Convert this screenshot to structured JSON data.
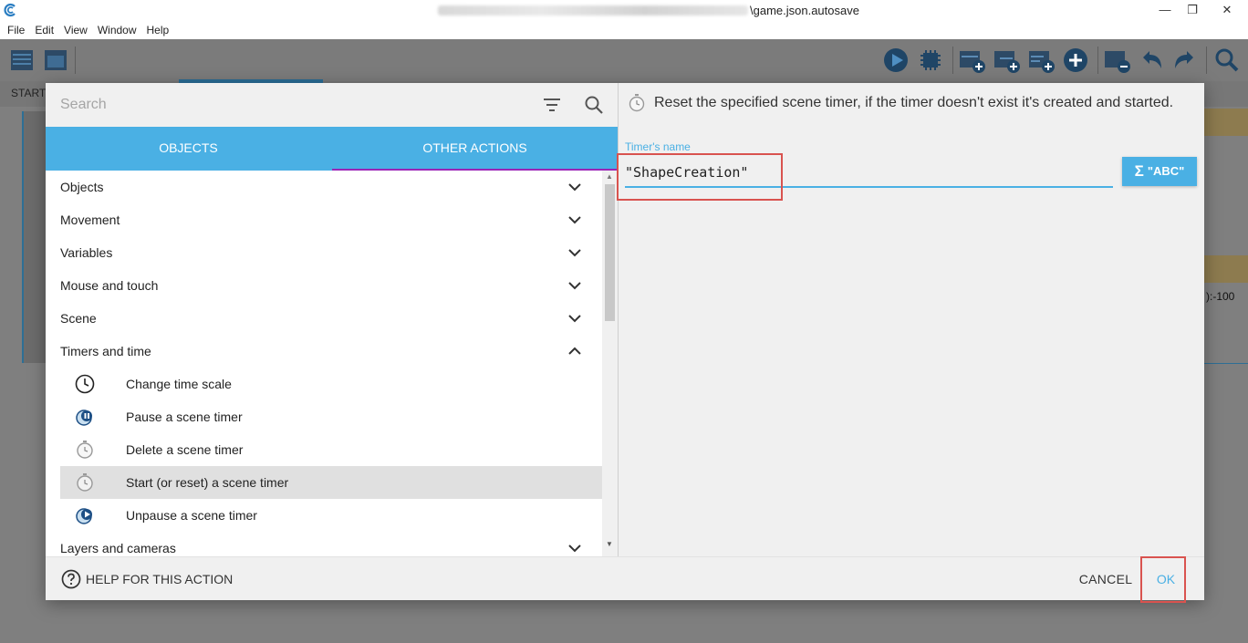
{
  "window": {
    "title_suffix": "\\game.json.autosave",
    "min_glyph": "—",
    "max_glyph": "❐",
    "close_glyph": "✕"
  },
  "menu": [
    "File",
    "Edit",
    "View",
    "Window",
    "Help"
  ],
  "background": {
    "tab_label": "START",
    "right_value": "):-100"
  },
  "search": {
    "placeholder": "Search"
  },
  "tabs": {
    "objects": "OBJECTS",
    "other_actions": "OTHER ACTIONS"
  },
  "categories": {
    "objects": "Objects",
    "movement": "Movement",
    "variables": "Variables",
    "mouse_touch": "Mouse and touch",
    "scene": "Scene",
    "timers": "Timers and time",
    "layers": "Layers and cameras"
  },
  "timer_actions": [
    {
      "label": "Change time scale",
      "icon": "clock-icon"
    },
    {
      "label": "Pause a scene timer",
      "icon": "pause-timer-icon"
    },
    {
      "label": "Delete a scene timer",
      "icon": "stopwatch-icon"
    },
    {
      "label": "Start (or reset) a scene timer",
      "icon": "stopwatch-icon",
      "selected": true
    },
    {
      "label": "Unpause a scene timer",
      "icon": "unpause-timer-icon"
    }
  ],
  "details": {
    "description": "Reset the specified scene timer, if the timer doesn't exist it's created and started.",
    "field_label": "Timer's name",
    "field_value": "\"ShapeCreation\"",
    "abc_label": "\"ABC\""
  },
  "footer": {
    "help": "HELP FOR THIS ACTION",
    "cancel": "CANCEL",
    "ok": "OK"
  },
  "colors": {
    "accent": "#4ab0e4",
    "tab_indicator": "#9b26b6",
    "highlight": "#d9534f"
  }
}
